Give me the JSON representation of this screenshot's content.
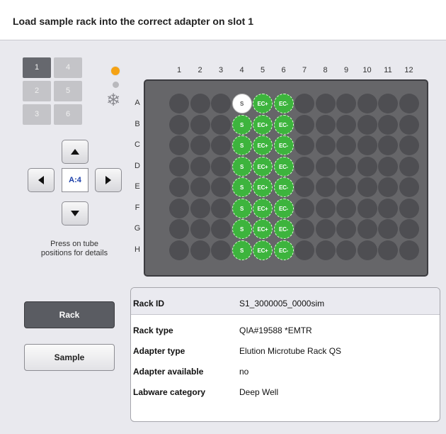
{
  "header": {
    "title": "Load sample rack into the correct adapter on slot 1"
  },
  "slots": [
    "1",
    "4",
    "2",
    "5",
    "3",
    "6"
  ],
  "selected_slot": "1",
  "navigator": {
    "position": "A:4"
  },
  "hint": "Press on tube positions for details",
  "plate": {
    "columns": [
      "1",
      "2",
      "3",
      "4",
      "5",
      "6",
      "7",
      "8",
      "9",
      "10",
      "11",
      "12"
    ],
    "rows": [
      "A",
      "B",
      "C",
      "D",
      "E",
      "F",
      "G",
      "H"
    ],
    "col4_labels": [
      "S",
      "S",
      "S",
      "S",
      "S",
      "S",
      "S",
      "S"
    ],
    "col5_label": "EC+",
    "col6_label": "EC-",
    "selected_well": "A4"
  },
  "tabs": {
    "rack": "Rack",
    "sample": "Sample"
  },
  "info": {
    "rack_id_label": "Rack ID",
    "rack_id_value": "S1_3000005_0000sim",
    "rows": [
      {
        "label": "Rack type",
        "value": "QIA#19588 *EMTR"
      },
      {
        "label": "Adapter type",
        "value": "Elution Microtube Rack QS"
      },
      {
        "label": "Adapter available",
        "value": "no"
      },
      {
        "label": "Labware category",
        "value": "Deep Well"
      }
    ]
  },
  "colors": {
    "accent_orange": "#f5a214",
    "tube_green": "#3db43d",
    "well_dark": "#4e4e52"
  }
}
